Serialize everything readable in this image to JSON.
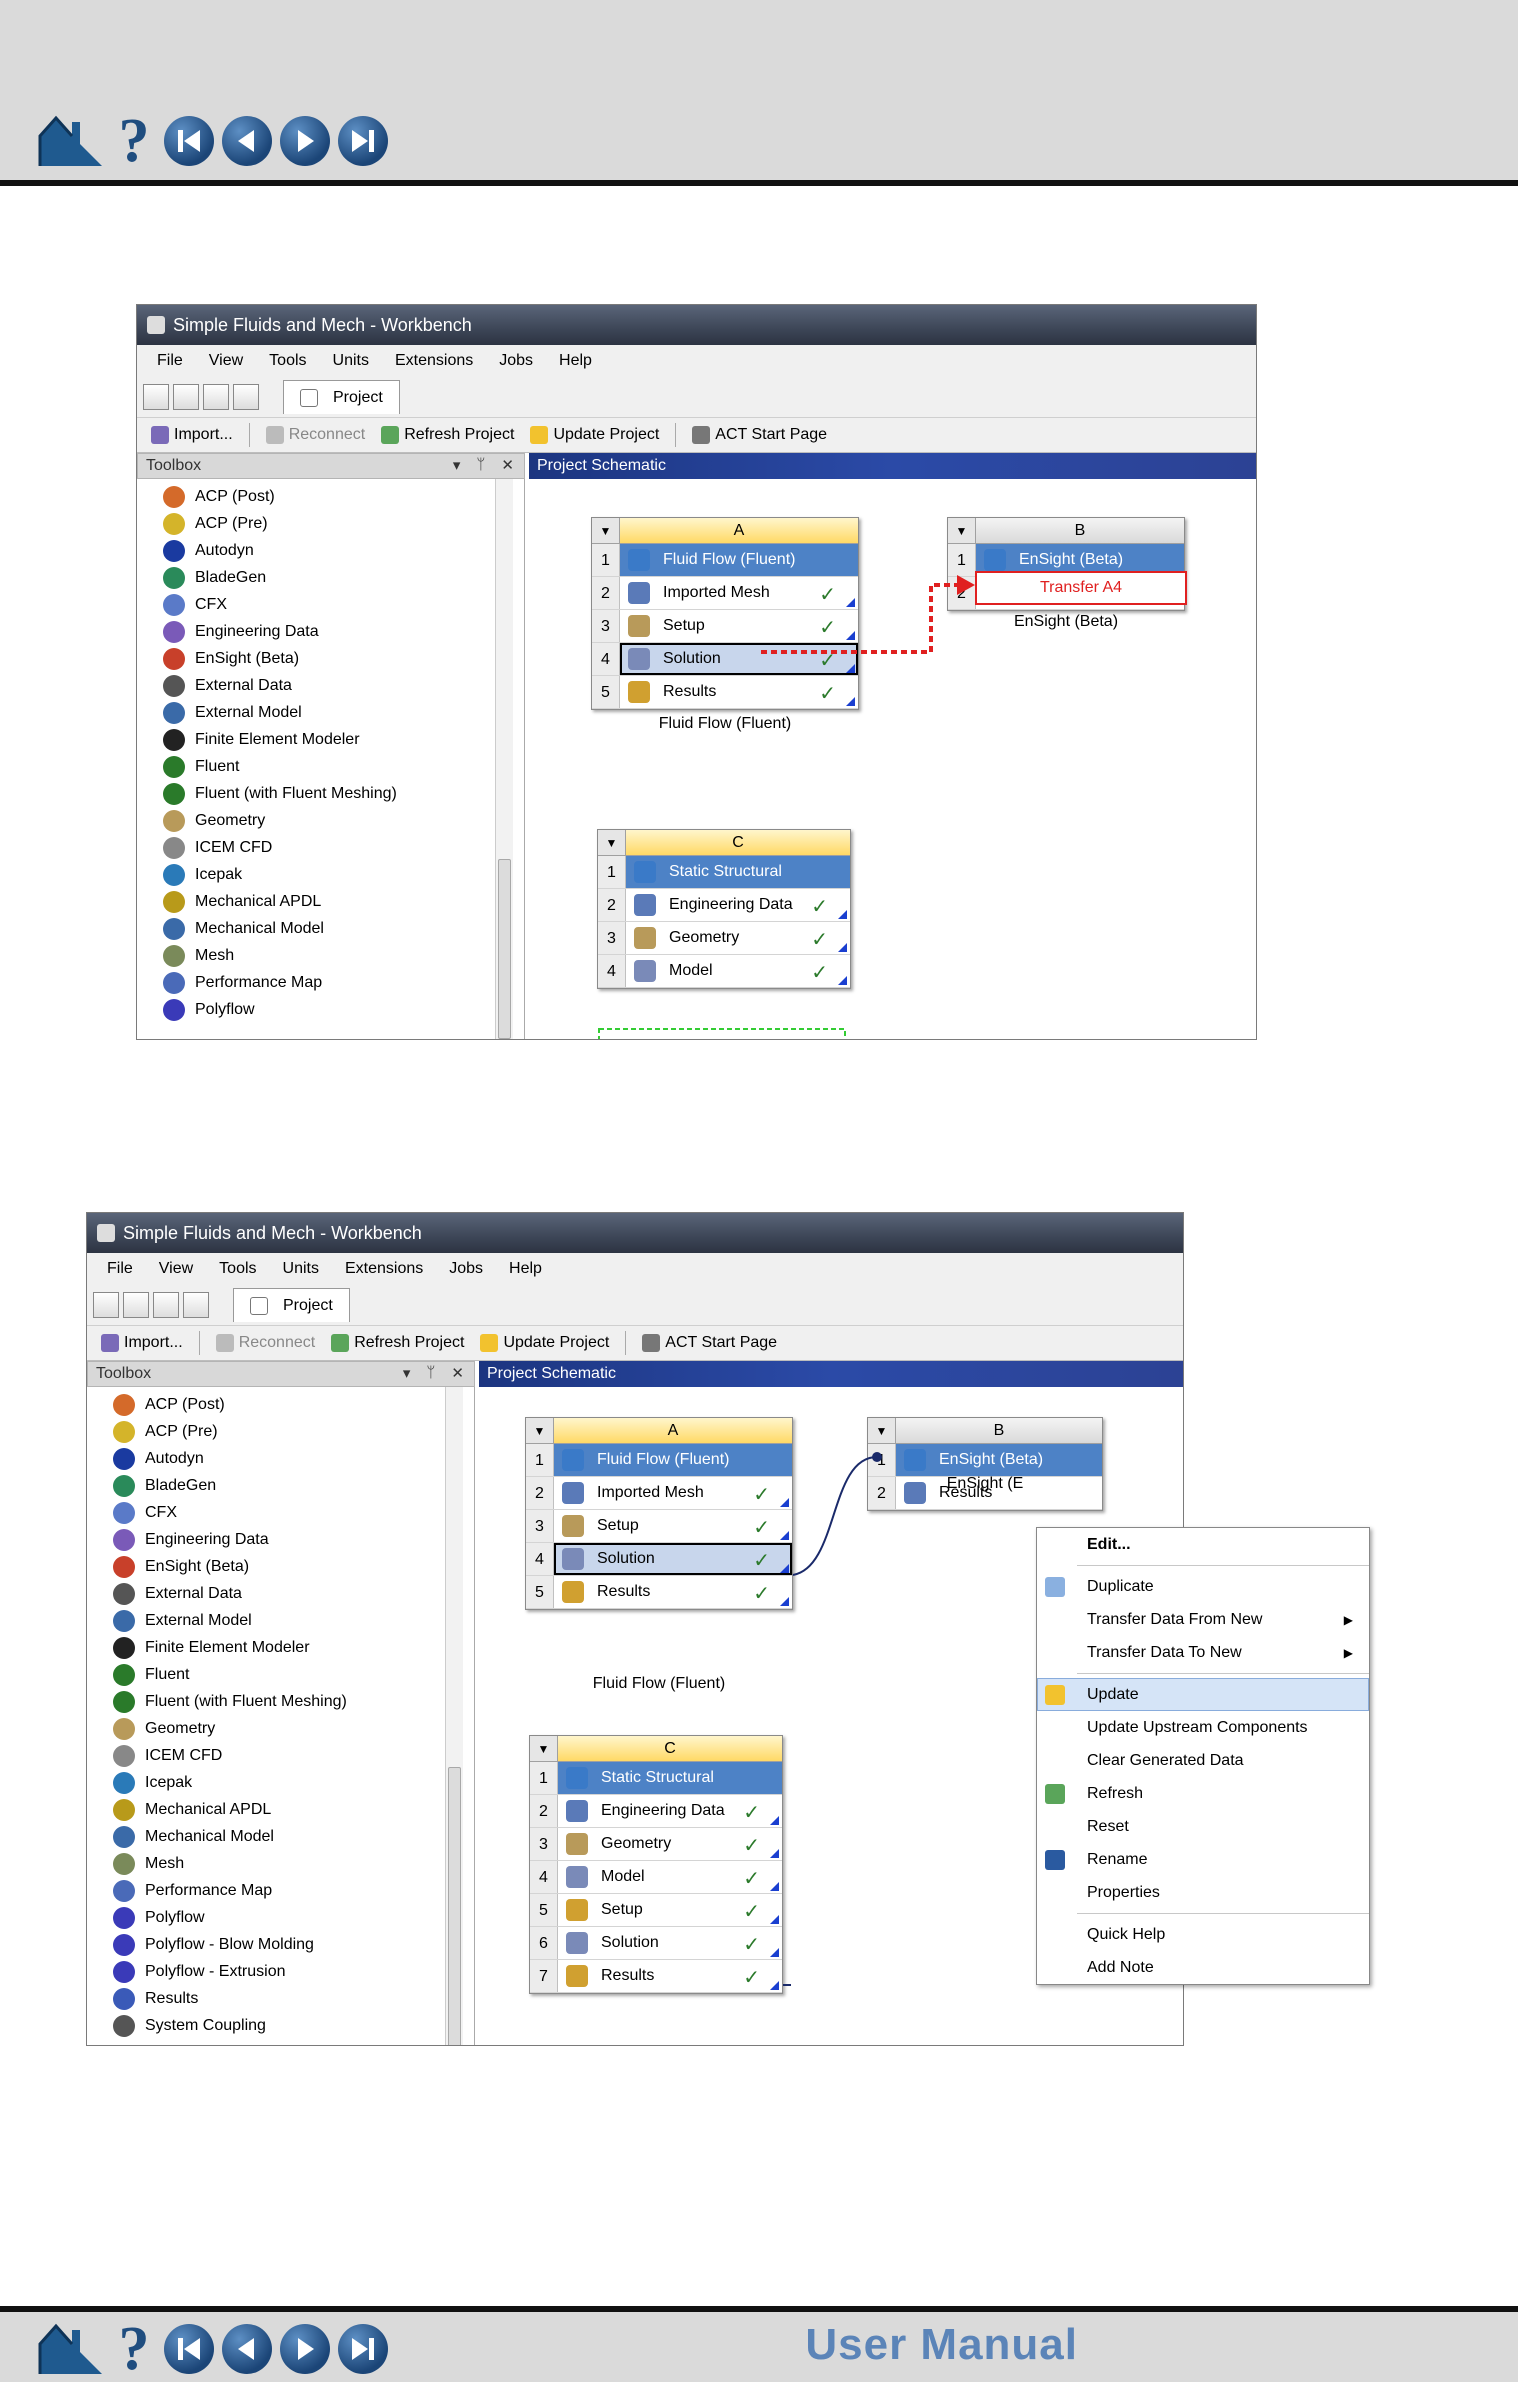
{
  "nav": {
    "icons": [
      "home-icon",
      "help-icon",
      "first-page-icon",
      "previous-page-icon",
      "next-page-icon",
      "last-page-icon"
    ],
    "manual_label": "User Manual"
  },
  "colors": {
    "title_gradient": "#3d4657",
    "blue_cell": "#4d82c6",
    "schematic_header": "#2b4aa7",
    "transfer_red": "#e02020",
    "check_green": "#2b7a2b"
  },
  "s1": {
    "title": "Simple Fluids and Mech - Workbench",
    "menu": [
      "File",
      "View",
      "Tools",
      "Units",
      "Extensions",
      "Jobs",
      "Help"
    ],
    "tab": "Project",
    "toolbar": {
      "import": "Import...",
      "reconnect": "Reconnect",
      "refresh": "Refresh Project",
      "update": "Update Project",
      "act": "ACT Start Page"
    },
    "toolbox_title": "Toolbox",
    "toolbox_ctrls": [
      "▾",
      "ᛘ",
      "✕"
    ],
    "toolbox": [
      "ACP (Post)",
      "ACP (Pre)",
      "Autodyn",
      "BladeGen",
      "CFX",
      "Engineering Data",
      "EnSight (Beta)",
      "External Data",
      "External Model",
      "Finite Element Modeler",
      "Fluent",
      "Fluent (with Fluent Meshing)",
      "Geometry",
      "ICEM CFD",
      "Icepak",
      "Mechanical APDL",
      "Mechanical Model",
      "Mesh",
      "Performance Map",
      "Polyflow"
    ],
    "schematic_title": "Project Schematic",
    "sysA": {
      "letter": "A",
      "rows": [
        "Fluid Flow (Fluent)",
        "Imported Mesh",
        "Setup",
        "Solution",
        "Results"
      ],
      "nums": [
        "1",
        "2",
        "3",
        "4",
        "5"
      ],
      "label": "Fluid Flow (Fluent)"
    },
    "sysB": {
      "letter": "B",
      "rows": [
        "EnSight (Beta)"
      ],
      "nums": [
        "1",
        "2"
      ],
      "transfer": "Transfer A4",
      "label": "EnSight (Beta)"
    },
    "sysC": {
      "letter": "C",
      "rows": [
        "Static Structural",
        "Engineering Data",
        "Geometry",
        "Model"
      ],
      "nums": [
        "1",
        "2",
        "3",
        "4"
      ]
    }
  },
  "s2": {
    "title": "Simple Fluids and Mech - Workbench",
    "menu": [
      "File",
      "View",
      "Tools",
      "Units",
      "Extensions",
      "Jobs",
      "Help"
    ],
    "tab": "Project",
    "toolbar": {
      "import": "Import...",
      "reconnect": "Reconnect",
      "refresh": "Refresh Project",
      "update": "Update Project",
      "act": "ACT Start Page"
    },
    "toolbox_title": "Toolbox",
    "toolbox_ctrls": [
      "▾",
      "ᛘ",
      "✕"
    ],
    "toolbox": [
      "ACP (Post)",
      "ACP (Pre)",
      "Autodyn",
      "BladeGen",
      "CFX",
      "Engineering Data",
      "EnSight (Beta)",
      "External Data",
      "External Model",
      "Finite Element Modeler",
      "Fluent",
      "Fluent (with Fluent Meshing)",
      "Geometry",
      "ICEM CFD",
      "Icepak",
      "Mechanical APDL",
      "Mechanical Model",
      "Mesh",
      "Performance Map",
      "Polyflow",
      "Polyflow - Blow Molding",
      "Polyflow - Extrusion",
      "Results",
      "System Coupling"
    ],
    "schematic_title": "Project Schematic",
    "sysA": {
      "letter": "A",
      "rows": [
        "Fluid Flow (Fluent)",
        "Imported Mesh",
        "Setup",
        "Solution",
        "Results"
      ],
      "nums": [
        "1",
        "2",
        "3",
        "4",
        "5"
      ],
      "label": "Fluid Flow (Fluent)"
    },
    "sysB": {
      "letter": "B",
      "rows": [
        "EnSight (Beta)",
        "Results"
      ],
      "nums": [
        "1",
        "2"
      ],
      "label": "EnSight (E"
    },
    "sysC": {
      "letter": "C",
      "rows": [
        "Static Structural",
        "Engineering Data",
        "Geometry",
        "Model",
        "Setup",
        "Solution",
        "Results"
      ],
      "nums": [
        "1",
        "2",
        "3",
        "4",
        "5",
        "6",
        "7"
      ]
    },
    "context_menu": [
      "Edit...",
      "Duplicate",
      "Transfer Data From New",
      "Transfer Data To New",
      "Update",
      "Update Upstream Components",
      "Clear Generated Data",
      "Refresh",
      "Reset",
      "Rename",
      "Properties",
      "Quick Help",
      "Add Note"
    ]
  }
}
